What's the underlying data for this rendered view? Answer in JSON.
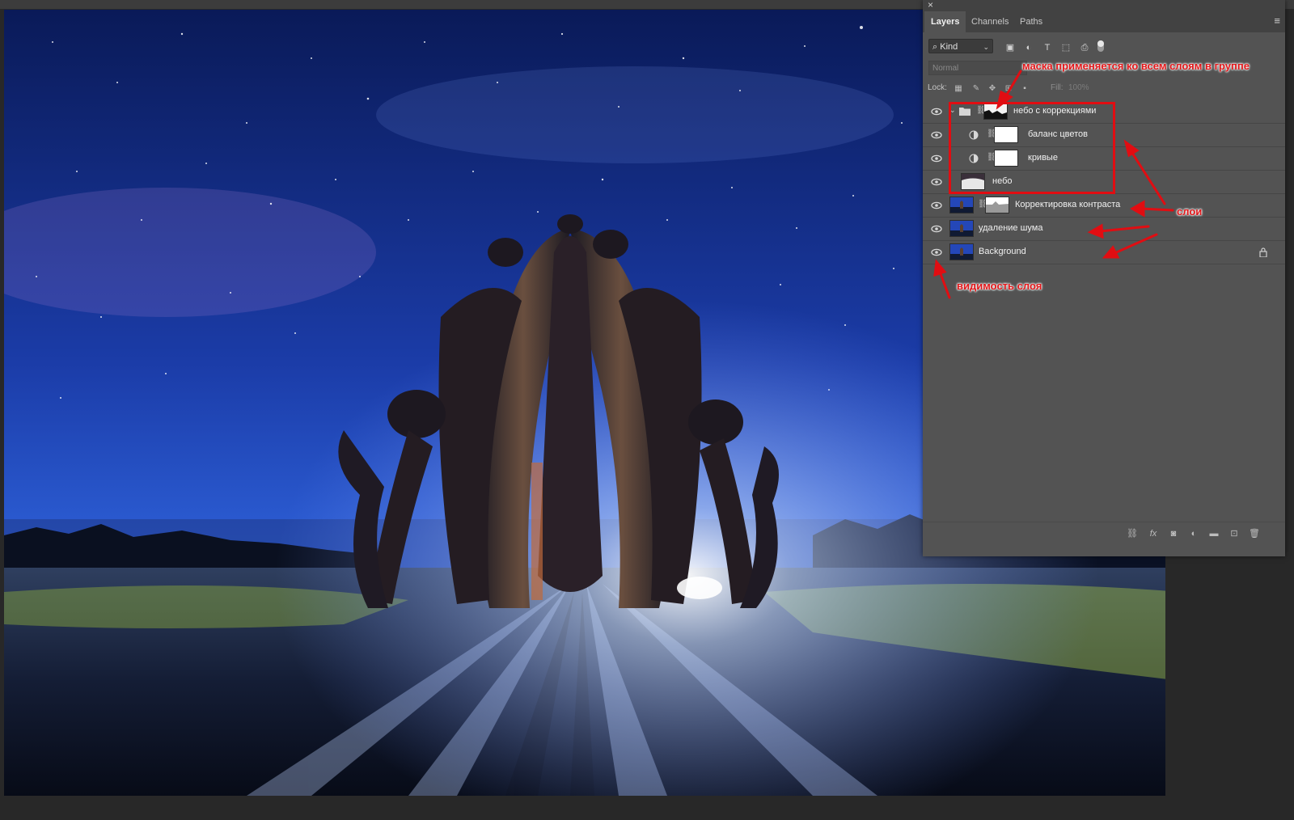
{
  "panel": {
    "close_glyph": "×",
    "menu_glyph": "≡",
    "tabs": [
      "Layers",
      "Channels",
      "Paths"
    ],
    "filter_kind": "Kind",
    "blend_mode": "Normal",
    "lock_label": "Lock:",
    "fill_label": "Fill:",
    "fill_value": "100%"
  },
  "layers": [
    {
      "name": "небо с коррекциями",
      "type": "group",
      "visible": true
    },
    {
      "name": "баланс цветов",
      "type": "adjustment",
      "visible": true
    },
    {
      "name": "кривые",
      "type": "adjustment",
      "visible": true
    },
    {
      "name": "небо",
      "type": "pixel",
      "visible": true
    },
    {
      "name": "Корректировка контраста",
      "type": "pixel-mask",
      "visible": true
    },
    {
      "name": "удаление шума",
      "type": "pixel",
      "visible": true
    },
    {
      "name": "Background",
      "type": "background",
      "visible": true,
      "locked": true
    }
  ],
  "annotations": {
    "mask_note": "маска применяется ко всем слоям в группе",
    "layers_note": "слои",
    "visibility_note": "видимость слоя"
  },
  "colors": {
    "panel_bg": "#535353",
    "annotation_red": "#e2171a",
    "sky_top": "#0b1a5c",
    "sky_bottom": "#2d57d6"
  },
  "icons": [
    "close-icon",
    "panel-menu-icon",
    "search-icon",
    "image-filter-icon",
    "adjustment-filter-icon",
    "type-filter-icon",
    "shape-filter-icon",
    "smart-object-filter-icon",
    "eye-icon",
    "folder-icon",
    "chain-link-icon",
    "lock-icon",
    "fx-icon",
    "mask-icon",
    "new-group-icon",
    "new-layer-icon",
    "trash-icon"
  ]
}
